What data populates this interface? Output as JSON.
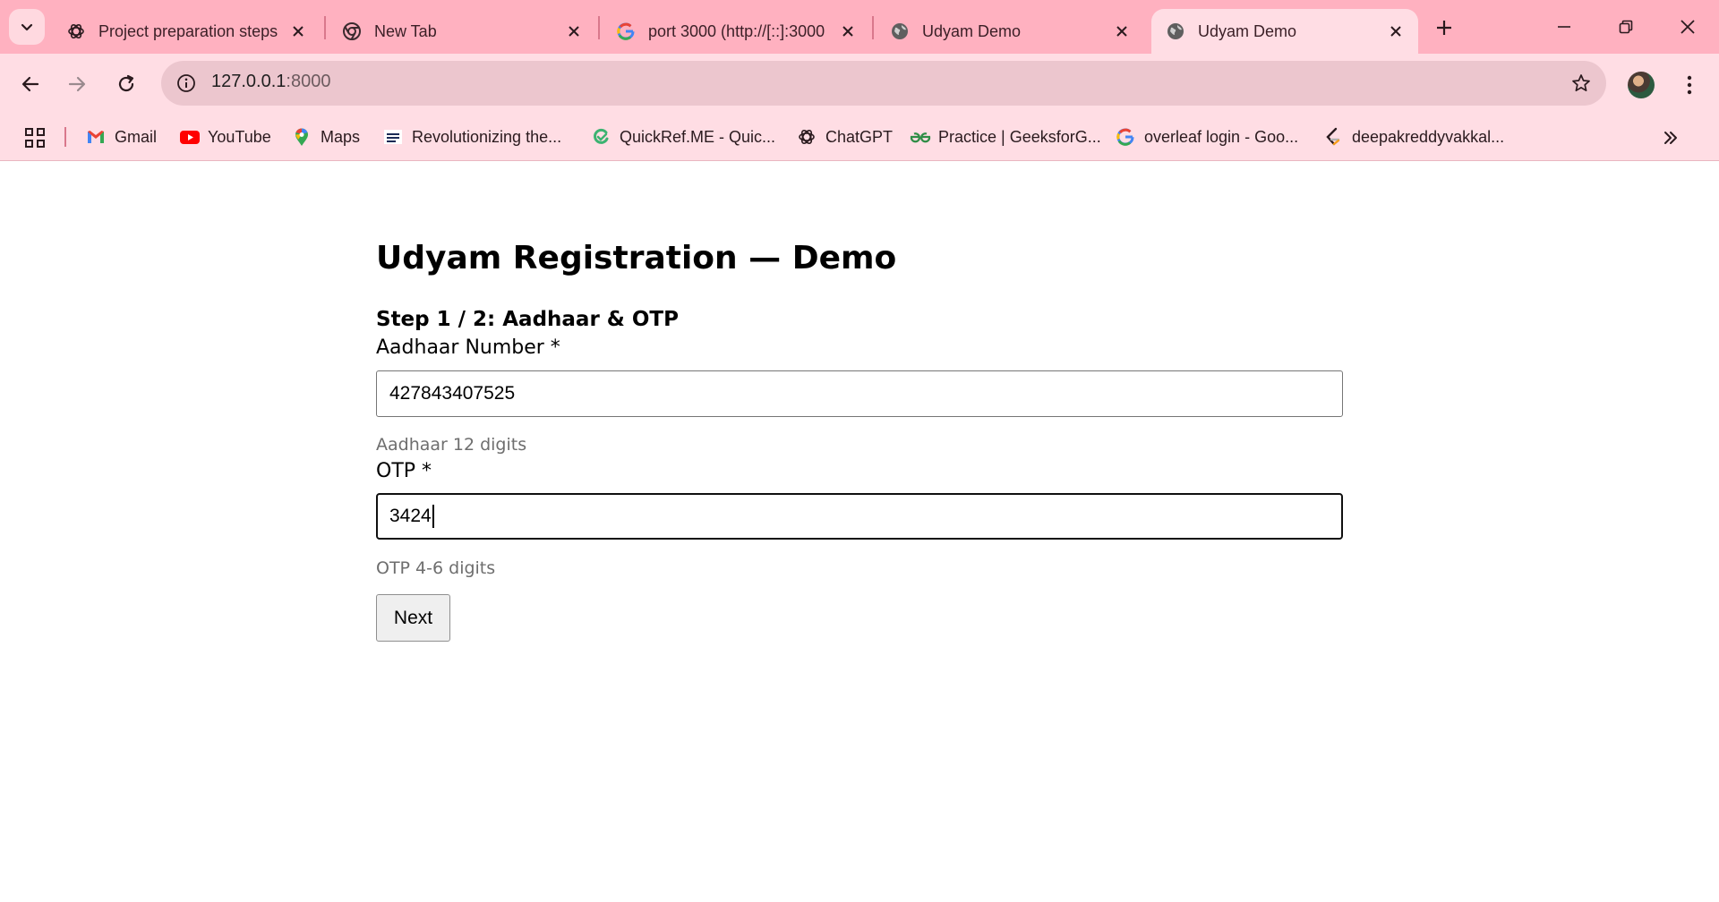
{
  "browser": {
    "tabs": [
      {
        "title": "Project preparation steps",
        "favicon": "chatgpt-icon",
        "active": false
      },
      {
        "title": "New Tab",
        "favicon": "chrome-icon",
        "active": false
      },
      {
        "title": "port 3000 (http://[::]:3000",
        "favicon": "google-icon",
        "active": false
      },
      {
        "title": "Udyam Demo",
        "favicon": "globe-icon",
        "active": false
      },
      {
        "title": "Udyam Demo",
        "favicon": "globe-icon",
        "active": true
      }
    ],
    "address": {
      "host": "127.0.0.1",
      "port": ":8000"
    },
    "bookmarks": [
      {
        "label": "Gmail",
        "icon": "gmail-icon"
      },
      {
        "label": "YouTube",
        "icon": "youtube-icon"
      },
      {
        "label": "Maps",
        "icon": "maps-icon"
      },
      {
        "label": "Revolutionizing the...",
        "icon": "nxtwave-icon"
      },
      {
        "label": "QuickRef.ME - Quic...",
        "icon": "quickref-icon"
      },
      {
        "label": "ChatGPT",
        "icon": "chatgpt-icon"
      },
      {
        "label": "Practice | GeeksforG...",
        "icon": "geeksforgeeks-icon"
      },
      {
        "label": "overleaf login - Goo...",
        "icon": "google-icon"
      },
      {
        "label": "deepakreddyvakkal...",
        "icon": "leetcode-icon"
      }
    ],
    "colors": {
      "tabstrip": "#ffb1c0",
      "toolbar": "#ffdde4",
      "omnibox": "#ecc6ce"
    }
  },
  "page": {
    "title": "Udyam Registration — Demo",
    "step": "Step 1 / 2: Aadhaar & OTP",
    "aadhaar": {
      "label": "Aadhaar Number *",
      "value": "427843407525",
      "hint": "Aadhaar 12 digits"
    },
    "otp": {
      "label": "OTP *",
      "value": "3424",
      "hint": "OTP 4-6 digits"
    },
    "next_label": "Next"
  }
}
